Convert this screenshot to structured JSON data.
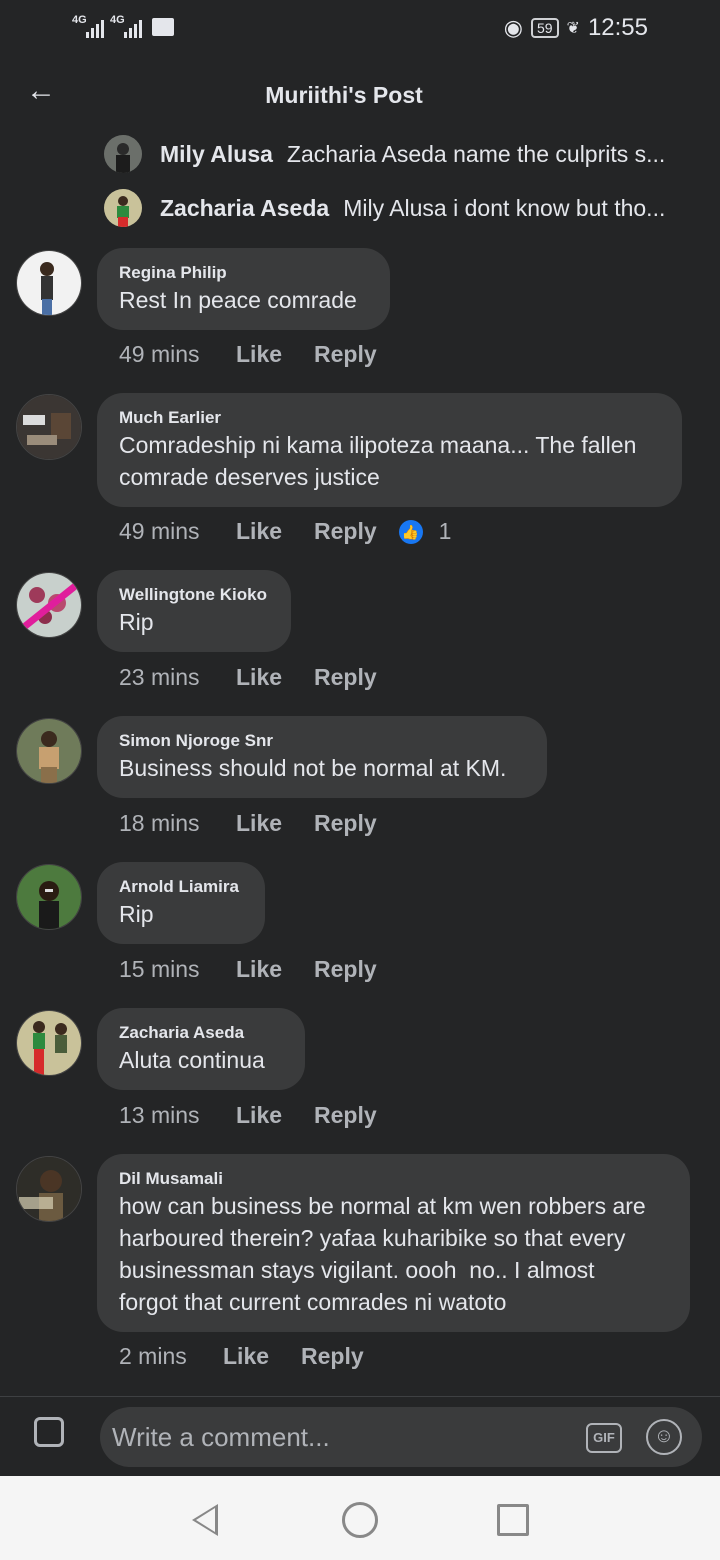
{
  "status": {
    "signal1": "4G",
    "signal2": "4G",
    "battery": "59",
    "time": "12:55"
  },
  "header": {
    "back_icon": "arrow-left-icon",
    "title": "Muriithi's Post"
  },
  "replies_preview": [
    {
      "name": "Mily Alusa",
      "text": "Zacharia Aseda name the culprits s..."
    },
    {
      "name": "Zacharia Aseda",
      "text": "Mily Alusa i dont know but tho..."
    }
  ],
  "comments": [
    {
      "name": "Regina Philip",
      "text": "Rest In peace comrade",
      "time": "49 mins",
      "like": "Like",
      "reply": "Reply"
    },
    {
      "name": "Much Earlier",
      "text_lines": [
        "Comradeship ni kama ilipoteza maana... The fallen",
        "comrade deserves justice"
      ],
      "time": "49 mins",
      "like": "Like",
      "reply": "Reply",
      "reactions": "1"
    },
    {
      "name": "Wellingtone Kioko",
      "text": "Rip",
      "time": "23 mins",
      "like": "Like",
      "reply": "Reply"
    },
    {
      "name": "Simon Njoroge Snr",
      "text": "Business should not be normal at KM.",
      "time": "18 mins",
      "like": "Like",
      "reply": "Reply"
    },
    {
      "name": "Arnold Liamira",
      "text": "Rip",
      "time": "15 mins",
      "like": "Like",
      "reply": "Reply"
    },
    {
      "name": "Zacharia Aseda",
      "text": "Aluta continua",
      "time": "13 mins",
      "like": "Like",
      "reply": "Reply"
    },
    {
      "name": "Dil Musamali",
      "text_lines": [
        "how can business be normal at km wen robbers are",
        "harboured therein? yafaa kuharibike so that every",
        "businessman stays vigilant. oooh  no.. I almost",
        "forgot that current comrades ni watoto"
      ],
      "time": "2 mins",
      "like": "Like",
      "reply": "Reply"
    }
  ],
  "composer": {
    "placeholder": "Write a comment...",
    "gif_label": "GIF"
  },
  "colors": {
    "background": "#242526",
    "bubble": "#3a3b3c",
    "like_blue": "#1877f2"
  }
}
